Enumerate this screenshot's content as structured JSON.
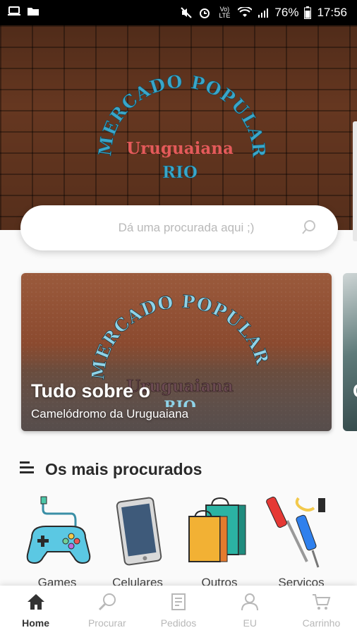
{
  "status_bar": {
    "battery": "76%",
    "time": "17:56",
    "network": "Vo) LTE"
  },
  "header": {
    "logo": {
      "arc_text": "MERCADO POPULAR",
      "middle_text": "Uruguaiana",
      "bottom_text": "RIO"
    }
  },
  "search": {
    "placeholder": "Dá uma procurada aqui ;)"
  },
  "banners": [
    {
      "title": "Tudo sobre o",
      "subtitle": "Camelódromo da Uruguaiana",
      "logo_arc_text": "MERCADO POPULAR",
      "logo_middle_text": "Uruguaiana",
      "logo_bottom_text": "RIO"
    },
    {
      "title_partial": "C"
    }
  ],
  "section": {
    "title": "Os mais procurados"
  },
  "categories": [
    {
      "label": "Games",
      "icon": "gamepad-icon"
    },
    {
      "label": "Celulares",
      "icon": "smartphone-icon"
    },
    {
      "label": "Outros",
      "icon": "shopping-bags-icon"
    },
    {
      "label": "Serviços",
      "icon": "tools-icon"
    }
  ],
  "bottom_nav": [
    {
      "label": "Home",
      "icon": "home-icon",
      "active": true
    },
    {
      "label": "Procurar",
      "icon": "search-icon",
      "active": false
    },
    {
      "label": "Pedidos",
      "icon": "orders-icon",
      "active": false
    },
    {
      "label": "EU",
      "icon": "user-icon",
      "active": false
    },
    {
      "label": "Carrinho",
      "icon": "cart-icon",
      "active": false
    }
  ],
  "colors": {
    "brick": "#6b3a22",
    "logo_teal": "#3aa6c9",
    "logo_red": "#e45a5a",
    "nav_inactive": "#b8b8b8",
    "nav_active": "#333333"
  }
}
